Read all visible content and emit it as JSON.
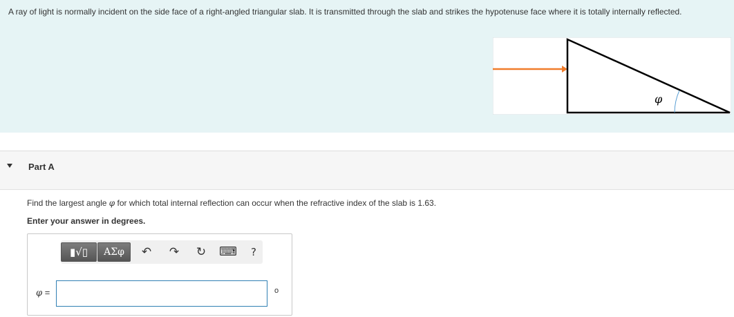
{
  "problem": {
    "text": "A ray of light is normally incident on the side face of a right-angled triangular slab. It is transmitted through the slab and strikes the hypotenuse face where it is totally internally reflected.",
    "figure_angle_symbol": "φ",
    "colors": {
      "ray": "#f07c2a",
      "slab": "#000000",
      "angle_arc": "#5a9fd4",
      "panel_bg": "#e6f4f5"
    }
  },
  "part": {
    "title": "Part A",
    "question_prefix": "Find the largest angle ",
    "question_symbol": "φ",
    "question_suffix": " for which total internal reflection can occur when the refractive index of the slab is 1.63.",
    "instruction": "Enter your answer in degrees."
  },
  "answer": {
    "label_symbol": "φ",
    "label_eq": " =",
    "input_value": "",
    "unit": "o"
  },
  "toolbar": {
    "templates_label": "▮√▯",
    "symbols_label": "ΑΣφ",
    "undo_icon": "↶",
    "redo_icon": "↷",
    "reset_icon": "↻",
    "keyboard_icon": "⌨",
    "help_label": "?"
  }
}
